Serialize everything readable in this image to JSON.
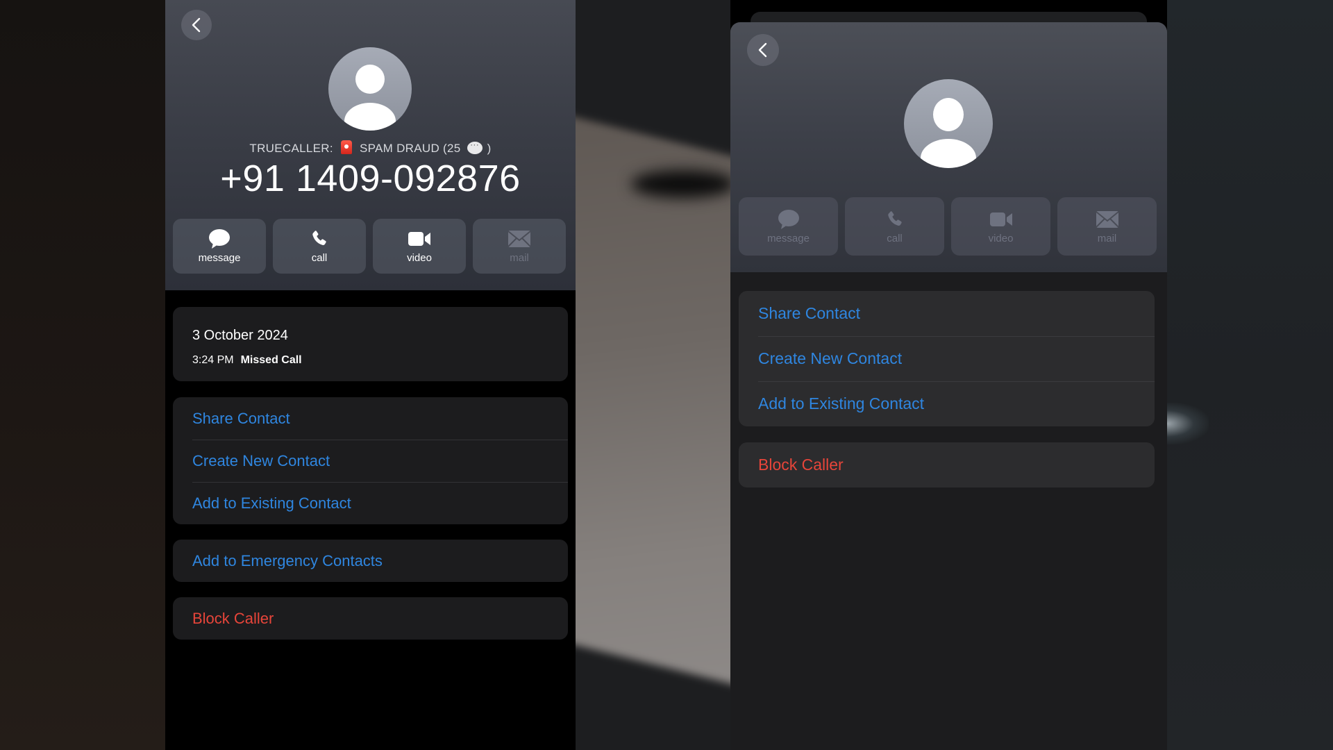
{
  "left_screen": {
    "back_button": {
      "icon": "chevron-left-icon"
    },
    "avatar": {
      "icon": "person-placeholder-icon"
    },
    "caller_id": {
      "prefix": "TRUECALLER:",
      "badge_icon": "siren-emoji-icon",
      "label": "SPAM DRAUD (25",
      "count_icon": "speech-bubble-emoji-icon",
      "suffix": ")"
    },
    "phone_number": "+91 1409-092876",
    "actions": [
      {
        "label": "message",
        "icon": "message-bubble-icon",
        "enabled": true
      },
      {
        "label": "call",
        "icon": "phone-icon",
        "enabled": true
      },
      {
        "label": "video",
        "icon": "video-camera-icon",
        "enabled": true
      },
      {
        "label": "mail",
        "icon": "envelope-icon",
        "enabled": false
      }
    ],
    "call_history": {
      "date": "3 October 2024",
      "time": "3:24 PM",
      "status": "Missed Call"
    },
    "contact_options": [
      "Share Contact",
      "Create New Contact",
      "Add to Existing Contact"
    ],
    "emergency_option": "Add to Emergency Contacts",
    "block_option": "Block Caller"
  },
  "right_screen": {
    "back_button": {
      "icon": "chevron-left-icon"
    },
    "avatar": {
      "icon": "person-placeholder-icon"
    },
    "actions": [
      {
        "label": "message",
        "icon": "message-bubble-icon",
        "enabled": false
      },
      {
        "label": "call",
        "icon": "phone-icon",
        "enabled": false
      },
      {
        "label": "video",
        "icon": "video-camera-icon",
        "enabled": false
      },
      {
        "label": "mail",
        "icon": "envelope-icon",
        "enabled": false
      }
    ],
    "contact_options": [
      "Share Contact",
      "Create New Contact",
      "Add to Existing Contact"
    ],
    "block_option": "Block Caller"
  },
  "colors": {
    "link_blue": "#2f86e0",
    "destructive_red": "#e7453a",
    "card_bg_left": "#1c1c1e",
    "card_bg_right": "#2c2c2e"
  }
}
